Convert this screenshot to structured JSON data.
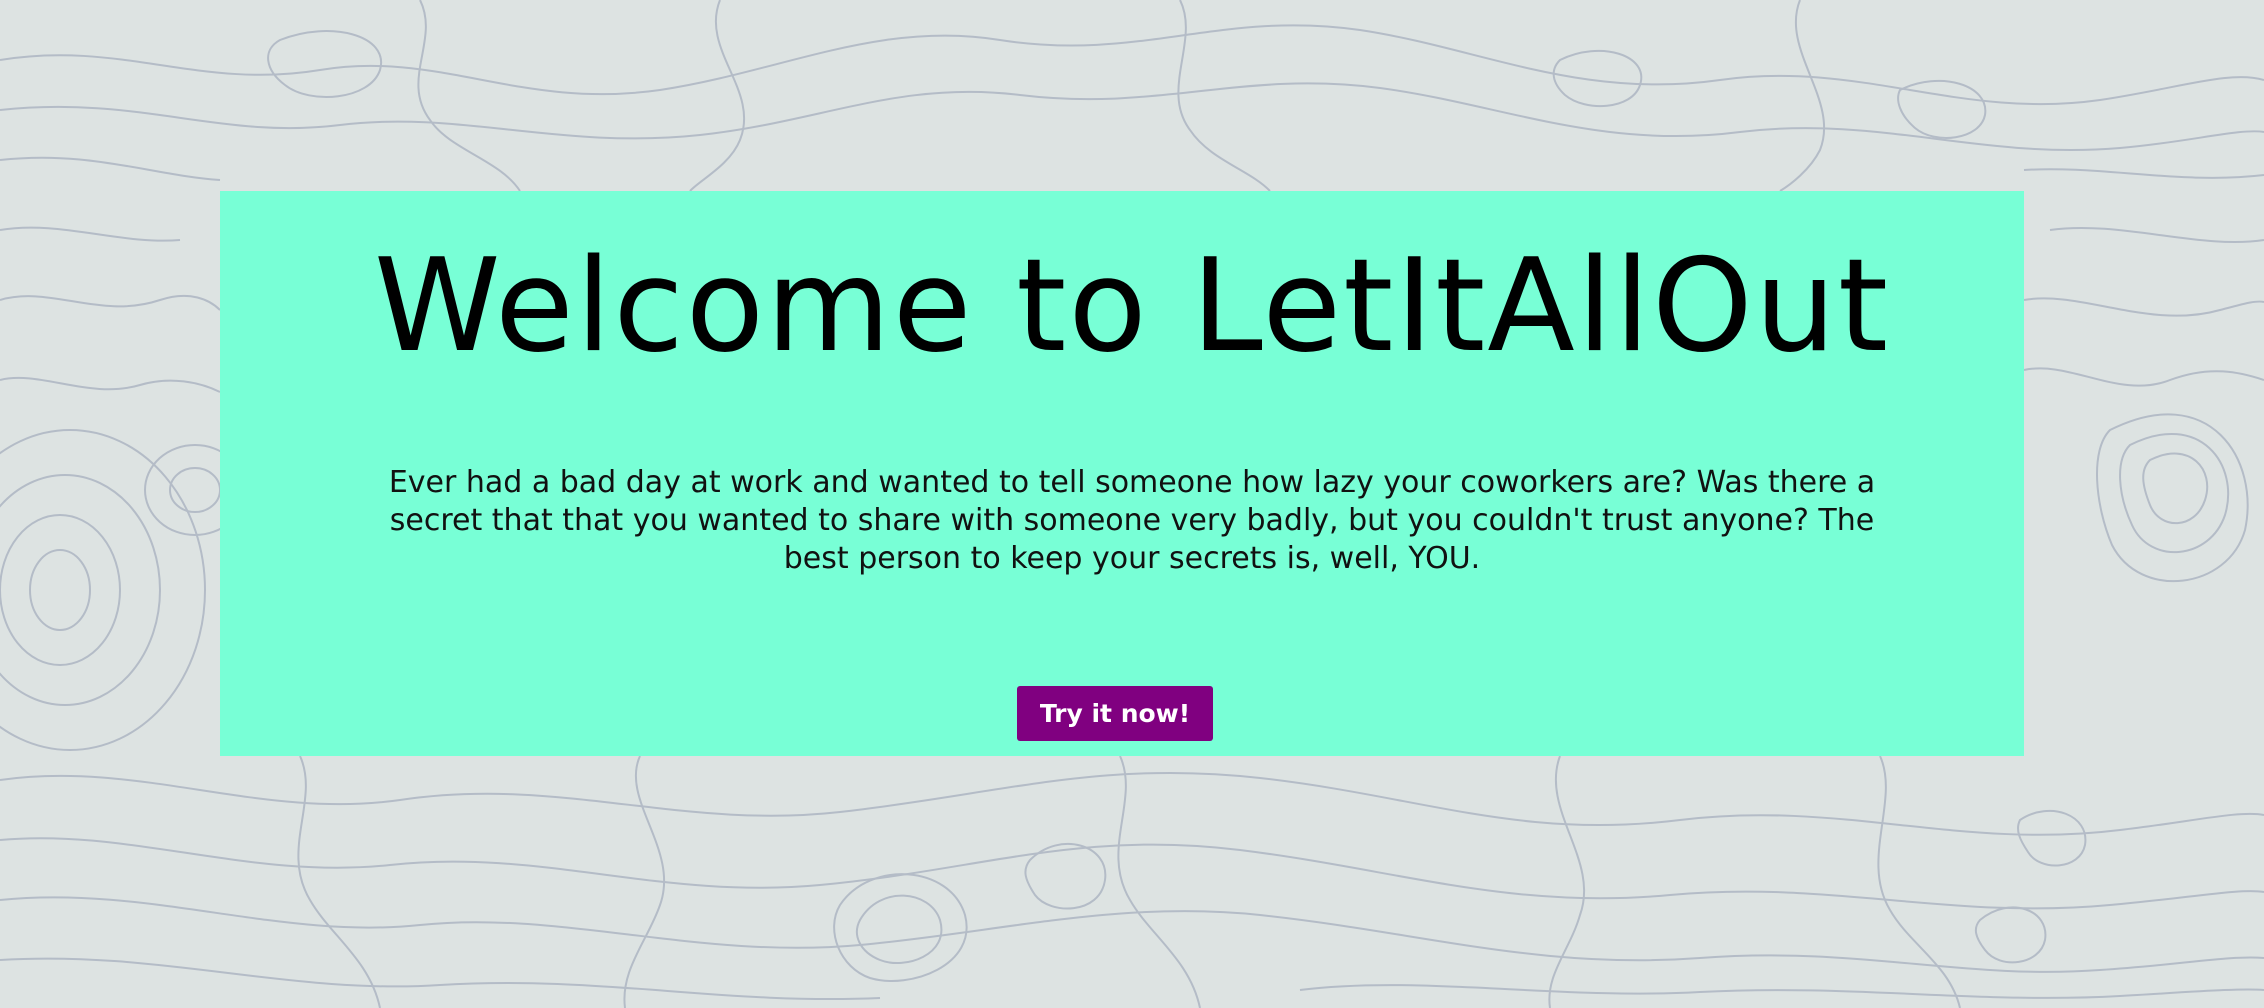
{
  "hero": {
    "title": "Welcome to LetItAllOut",
    "description": "Ever had a bad day at work and wanted to tell someone how lazy your coworkers are? Was there a secret that that you wanted to share with someone very badly, but you couldn't trust anyone? The best person to keep your secrets is, well, YOU.",
    "cta_label": "Try it now!"
  },
  "colors": {
    "page_background": "#dde3e2",
    "contour_lines": "#b4bcc7",
    "panel_background": "#78ffd6",
    "button_background": "#800080",
    "button_text": "#ffffff"
  }
}
